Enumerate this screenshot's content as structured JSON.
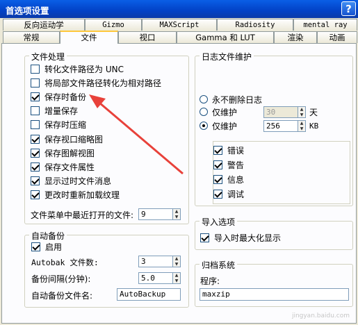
{
  "window": {
    "title": "首选项设置",
    "help": "?"
  },
  "tabs_back": [
    "反向运动学",
    "Gizmo",
    "MAXScript",
    "Radiosity",
    "mental ray"
  ],
  "tabs_front": [
    "常规",
    "文件",
    "视口",
    "Gamma 和 LUT",
    "渲染",
    "动画"
  ],
  "file_handling": {
    "title": "文件处理",
    "items": [
      {
        "label": "转化文件路径为 UNC",
        "checked": false
      },
      {
        "label": "将局部文件路径转化为相对路径",
        "checked": false
      },
      {
        "label": "保存时备份",
        "checked": true
      },
      {
        "label": "增量保存",
        "checked": false
      },
      {
        "label": "保存时压缩",
        "checked": false
      },
      {
        "label": "保存视口缩略图",
        "checked": true
      },
      {
        "label": "保存图解视图",
        "checked": true
      },
      {
        "label": "保存文件属性",
        "checked": true
      },
      {
        "label": "显示过时文件消息",
        "checked": true
      },
      {
        "label": "更改时重新加载纹理",
        "checked": true
      }
    ],
    "recent_label": "文件菜单中最近打开的文件:",
    "recent_value": "9"
  },
  "log": {
    "title": "日志文件维护",
    "never_delete": "永不删除日志",
    "keep_days": "仅维护",
    "days_value": "30",
    "days_unit": "天",
    "keep_kb": "仅维护",
    "kb_value": "256",
    "kb_unit": "KB",
    "levels": [
      {
        "label": "错误",
        "checked": true
      },
      {
        "label": "警告",
        "checked": true
      },
      {
        "label": "信息",
        "checked": true
      },
      {
        "label": "调试",
        "checked": true
      }
    ]
  },
  "autobackup": {
    "title": "自动备份",
    "enable": "启用",
    "count_label": "Autobak 文件数:",
    "count_value": "3",
    "interval_label": "备份间隔(分钟):",
    "interval_value": "5.0",
    "name_label": "自动备份文件名:",
    "name_value": "AutoBackup"
  },
  "import": {
    "title": "导入选项",
    "maximize": "导入时最大化显示"
  },
  "archive": {
    "title": "归档系统",
    "program_label": "程序:",
    "program_value": "maxzip"
  },
  "watermark": "jingyan.baidu.com",
  "colors": {
    "arrow": "#e8413a",
    "title_bar": "#0241c6",
    "tab_highlight": "#ffc83c"
  }
}
